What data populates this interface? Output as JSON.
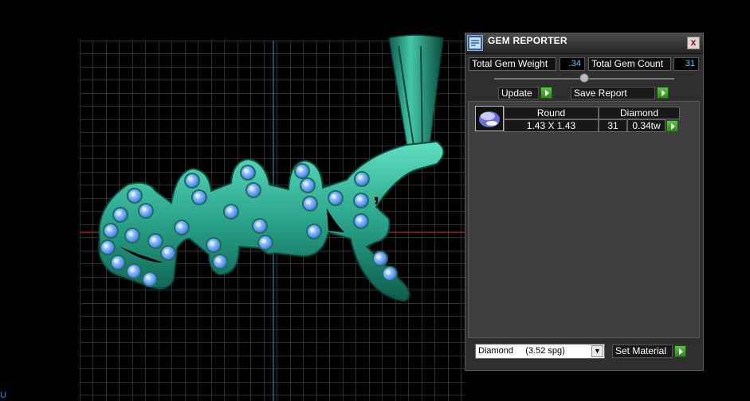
{
  "panel": {
    "title": "GEM REPORTER",
    "close_label": "x",
    "total_weight_label": "Total Gem Weight",
    "total_weight_value": ".34",
    "total_count_label": "Total Gem Count",
    "total_count_value": "31",
    "update_label": "Update",
    "save_report_label": "Save Report"
  },
  "report": {
    "rows": [
      {
        "shape": "Round",
        "size": "1.43 X 1.43",
        "material": "Diamond",
        "count": "31",
        "weight": "0.34tw"
      }
    ]
  },
  "material": {
    "selected": "Diamond     (3.52 spg)",
    "set_label": "Set Material"
  },
  "viewport": {
    "corner_label": "U"
  },
  "colors": {
    "model": "#2aa38a",
    "gem": "#6ea8ff",
    "grid": "#5a5a5a",
    "axis_x": "#cc2a1a",
    "axis_y": "#1b8fa0",
    "accent_button": "#4cb23a"
  }
}
